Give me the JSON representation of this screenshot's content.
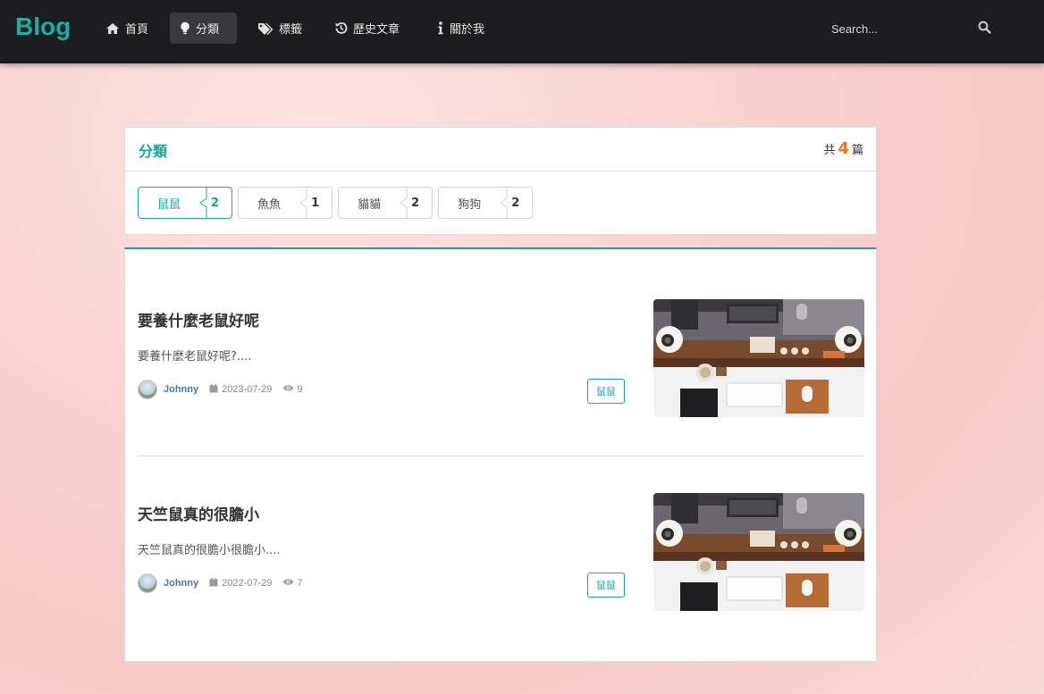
{
  "brand": "Blog",
  "nav": {
    "items": [
      {
        "label": "首頁",
        "icon": "home-icon"
      },
      {
        "label": "分類",
        "icon": "lightbulb-icon"
      },
      {
        "label": "標籤",
        "icon": "tags-icon"
      },
      {
        "label": "歷史文章",
        "icon": "history-icon"
      },
      {
        "label": "關於我",
        "icon": "info-icon"
      }
    ],
    "active": "分類",
    "search_placeholder": "Search..."
  },
  "category_panel": {
    "title": "分類",
    "count_prefix": "共",
    "count": "4",
    "count_suffix": "篇",
    "categories": [
      {
        "name": "鼠鼠",
        "count": "2",
        "active": true
      },
      {
        "name": "魚魚",
        "count": "1",
        "active": false
      },
      {
        "name": "貓貓",
        "count": "2",
        "active": false
      },
      {
        "name": "狗狗",
        "count": "2",
        "active": false
      }
    ]
  },
  "posts": [
    {
      "title": "要養什麼老鼠好呢",
      "excerpt": "要養什麼老鼠好呢?....",
      "author": "Johnny",
      "date": "2023-07-29",
      "views": "9",
      "tag": "鼠鼠"
    },
    {
      "title": "天竺鼠真的很膽小",
      "excerpt": "天竺鼠真的很膽小很膽小....",
      "author": "Johnny",
      "date": "2022-07-29",
      "views": "7",
      "tag": "鼠鼠"
    }
  ],
  "colors": {
    "accent": "#12a89d",
    "brand": "#12b3a7",
    "navbar": "#1d1d1f",
    "count_highlight": "#f2711c",
    "author": "#4a76b8"
  }
}
